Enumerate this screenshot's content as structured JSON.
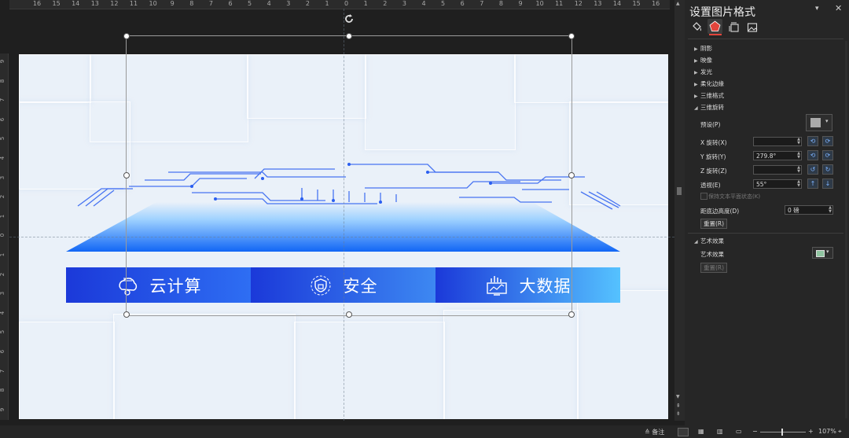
{
  "ruler": {
    "top_ticks": [
      "16",
      "15",
      "14",
      "13",
      "12",
      "11",
      "10",
      "9",
      "8",
      "7",
      "6",
      "5",
      "4",
      "3",
      "2",
      "1",
      "0",
      "1",
      "2",
      "3",
      "4",
      "5",
      "6",
      "7",
      "8",
      "9",
      "10",
      "11",
      "12",
      "13",
      "14",
      "15",
      "16"
    ],
    "left_ticks": [
      "9",
      "8",
      "7",
      "6",
      "5",
      "4",
      "3",
      "2",
      "1",
      "0",
      "1",
      "2",
      "3",
      "4",
      "5",
      "6",
      "7",
      "8",
      "9"
    ]
  },
  "slide": {
    "segments": [
      {
        "label": "云计算",
        "icon": "cloud-computing-icon",
        "colors": [
          "#1b39d9",
          "#2e6ef3"
        ]
      },
      {
        "label": "安全",
        "icon": "security-shield-icon",
        "colors": [
          "#1b39d9",
          "#3d88f2"
        ]
      },
      {
        "label": "大数据",
        "icon": "big-data-icon",
        "colors": [
          "#1b39d9",
          "#55c2ff"
        ]
      }
    ],
    "accent": "#1f5ff0"
  },
  "pane": {
    "title": "设置图片格式",
    "tabs": [
      {
        "name": "fill-line-tab",
        "icon": "paint-bucket-icon"
      },
      {
        "name": "effects-tab",
        "icon": "pentagon-icon"
      },
      {
        "name": "size-properties-tab",
        "icon": "size-icon"
      },
      {
        "name": "picture-tab",
        "icon": "picture-icon"
      }
    ],
    "sections": {
      "shadow": "阴影",
      "reflection": "映像",
      "glow": "发光",
      "soft_edges": "柔化边缘",
      "format_3d": "三维格式",
      "rotation_3d": "三维旋转",
      "artistic": "艺术效果"
    },
    "rotation": {
      "preset_label": "预设(P)",
      "x_label": "X 旋转(X)",
      "x_value": "",
      "y_label": "Y 旋转(Y)",
      "y_value": "279.8°",
      "z_label": "Z 旋转(Z)",
      "z_value": "",
      "perspective_label": "透视(E)",
      "perspective_value": "55°",
      "keep_flat_label": "保持文本平面状态(K)",
      "distance_label": "距底边高度(D)",
      "distance_value": "0 磅",
      "reset_label": "重置(R)"
    },
    "artistic": {
      "effect_label": "艺术效果",
      "reset_label": "重置(R)"
    }
  },
  "status": {
    "notes_label": "备注",
    "zoom": "107%"
  }
}
